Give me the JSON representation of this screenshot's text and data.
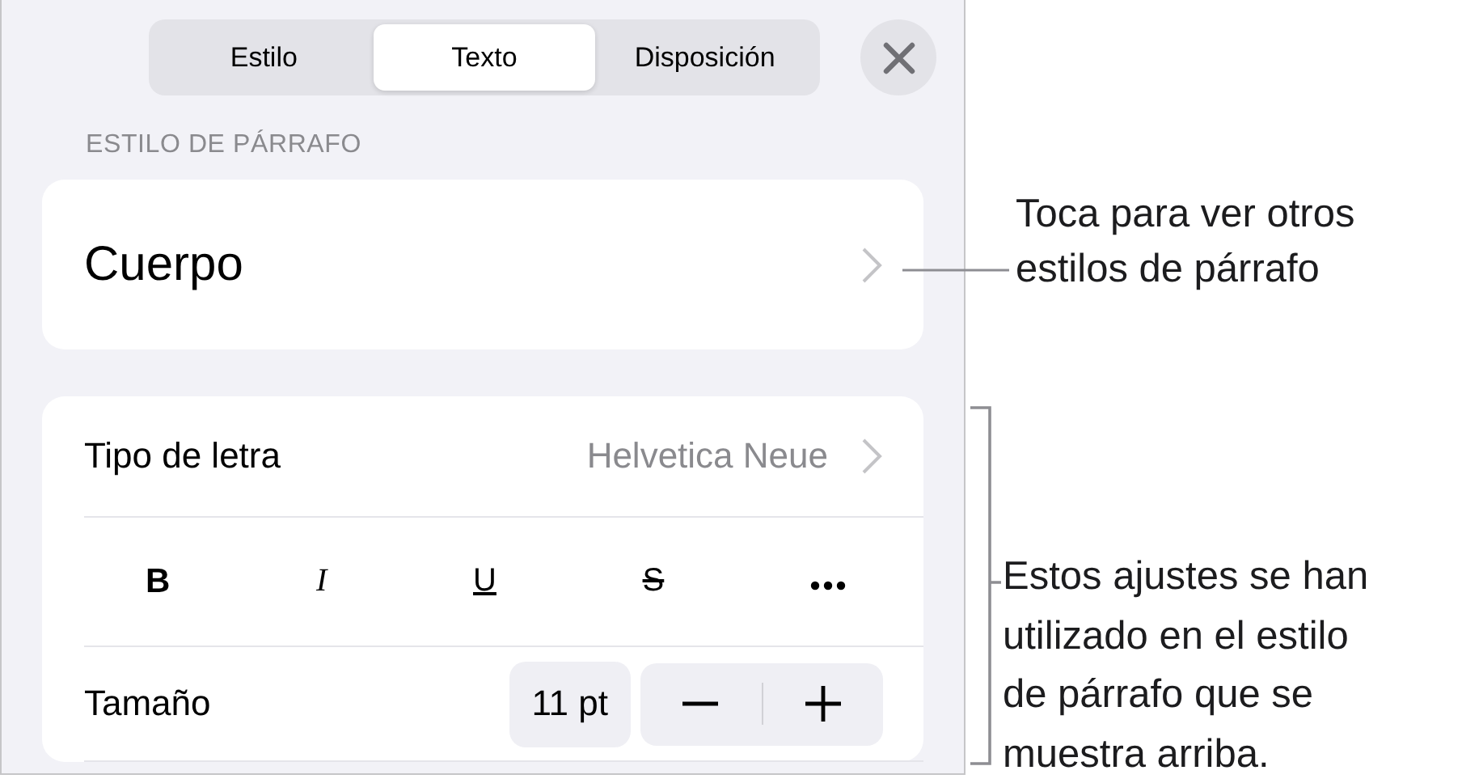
{
  "tabs": [
    {
      "label": "Estilo",
      "selected": false
    },
    {
      "label": "Texto",
      "selected": true
    },
    {
      "label": "Disposición",
      "selected": false
    }
  ],
  "section_header": "ESTILO DE PÁRRAFO",
  "paragraph_style": {
    "value": "Cuerpo"
  },
  "font_row": {
    "label": "Tipo de letra",
    "value": "Helvetica Neue"
  },
  "format_buttons": [
    {
      "kind": "bold",
      "label": "B"
    },
    {
      "kind": "italic",
      "label": "I"
    },
    {
      "kind": "underline",
      "label": "U"
    },
    {
      "kind": "strikethrough",
      "label": "S"
    },
    {
      "kind": "more"
    }
  ],
  "size_row": {
    "label": "Tamaño",
    "value": "11 pt"
  },
  "callouts": [
    {
      "kind": "leader",
      "text": "Toca para ver otros\nestilos de párrafo"
    },
    {
      "kind": "bracket",
      "text": "Estos ajustes se han\nutilizado en el estilo\nde párrafo que se\nmuestra arriba."
    }
  ]
}
